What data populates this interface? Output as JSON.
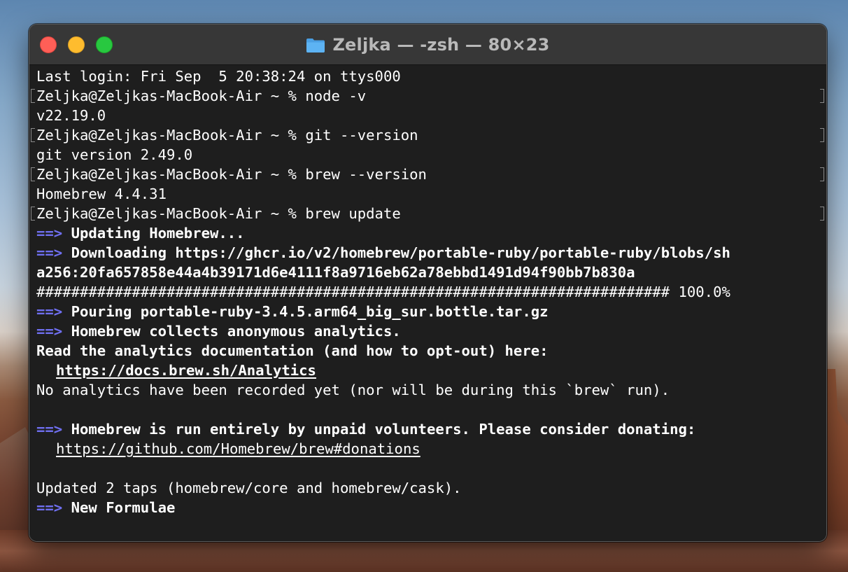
{
  "window": {
    "title": "Zeljka — -zsh — 80×23"
  },
  "terminal": {
    "lines": [
      {
        "text": "Last login: Fri Sep  5 20:38:24 on ttys000"
      },
      {
        "text": "Zeljka@Zeljkas-MacBook-Air ~ % node -v"
      },
      {
        "text": "v22.19.0"
      },
      {
        "text": "Zeljka@Zeljkas-MacBook-Air ~ % git --version"
      },
      {
        "text": "git version 2.49.0"
      },
      {
        "text": "Zeljka@Zeljkas-MacBook-Air ~ % brew --version"
      },
      {
        "text": "Homebrew 4.4.31"
      },
      {
        "text": "Zeljka@Zeljkas-MacBook-Air ~ % brew update"
      },
      {
        "arrow": "==>",
        "text": " Updating Homebrew..."
      },
      {
        "arrow": "==>",
        "text": " Downloading https://ghcr.io/v2/homebrew/portable-ruby/portable-ruby/blobs/sh"
      },
      {
        "text": "a256:20fa657858e44a4b39171d6e4111f8a9716eb62a78ebbd1491d94f90bb7b830a"
      },
      {
        "text": "######################################################################### 100.0%"
      },
      {
        "arrow": "==>",
        "text": " Pouring portable-ruby-3.4.5.arm64_big_sur.bottle.tar.gz"
      },
      {
        "arrow": "==>",
        "text": " Homebrew collects anonymous analytics."
      },
      {
        "text": "Read the analytics documentation (and how to opt-out) here:"
      },
      {
        "text": "https://docs.brew.sh/Analytics"
      },
      {
        "text": "No analytics have been recorded yet (nor will be during this `brew` run)."
      },
      {
        "arrow": "==>",
        "text": " Homebrew is run entirely by unpaid volunteers. Please consider donating:"
      },
      {
        "text": "https://github.com/Homebrew/brew#donations"
      },
      {
        "text": "Updated 2 taps (homebrew/core and homebrew/cask)."
      },
      {
        "arrow": "==>",
        "text": " New Formulae"
      }
    ]
  },
  "colors": {
    "arrow": "#6f6ff0",
    "text": "#ffffff",
    "background": "#1e1e1e",
    "titlebar": "#373737"
  },
  "icons": {
    "title": "folder-icon"
  }
}
